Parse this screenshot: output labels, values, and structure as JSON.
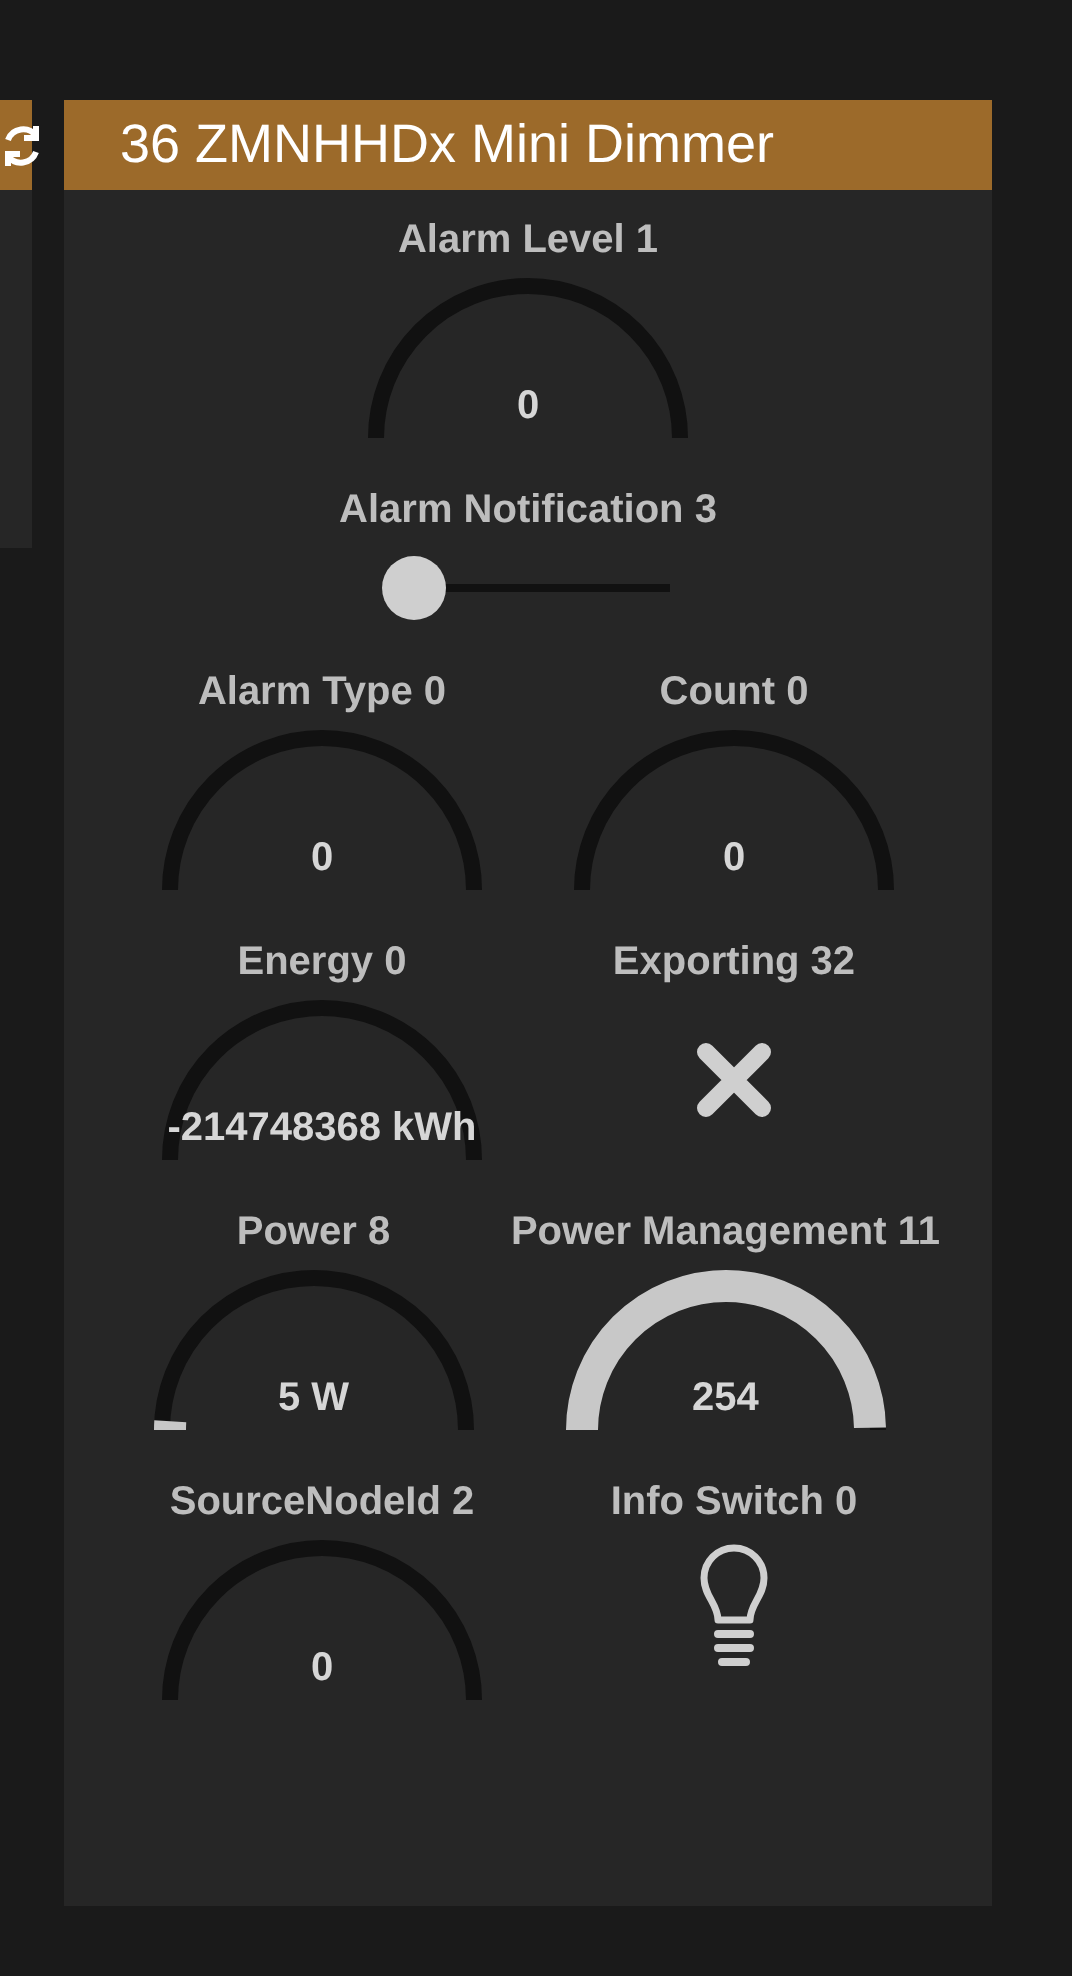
{
  "panel": {
    "title": "36 ZMNHHDx Mini Dimmer"
  },
  "rows": [
    [
      {
        "kind": "gauge",
        "label": "Alarm Level 1",
        "value": "0"
      }
    ],
    [
      {
        "kind": "slider",
        "label": "Alarm Notification 3",
        "level": 0
      }
    ],
    [
      {
        "kind": "gauge",
        "label": "Alarm Type 0",
        "value": "0"
      },
      {
        "kind": "gauge",
        "label": "Count 0",
        "value": "0"
      }
    ],
    [
      {
        "kind": "gauge",
        "label": "Energy 0",
        "value": "-214748368 kWh"
      },
      {
        "kind": "cross",
        "label": "Exporting 32"
      }
    ],
    [
      {
        "kind": "gauge",
        "label": "Power 8",
        "value": "5 W"
      },
      {
        "kind": "gauge",
        "label": "Power Management 11",
        "value": "254"
      }
    ],
    [
      {
        "kind": "gauge",
        "label": "SourceNodeId 2",
        "value": "0"
      },
      {
        "kind": "bulb",
        "label": "Info Switch 0"
      }
    ]
  ]
}
